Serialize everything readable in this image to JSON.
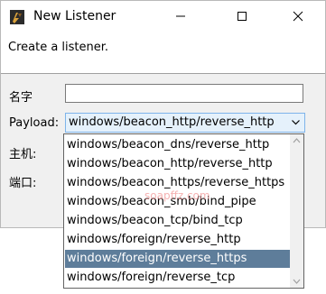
{
  "window": {
    "title": "New Listener",
    "description": "Create a listener."
  },
  "form": {
    "name_label": "名字",
    "name_value": "",
    "payload_label": "Payload:",
    "payload_value": "windows/beacon_http/reverse_http",
    "host_label": "主机:",
    "port_label": "端口:"
  },
  "dropdown": {
    "options": [
      "windows/beacon_dns/reverse_http",
      "windows/beacon_http/reverse_http",
      "windows/beacon_https/reverse_https",
      "windows/beacon_smb/bind_pipe",
      "windows/beacon_tcp/bind_tcp",
      "windows/foreign/reverse_http",
      "windows/foreign/reverse_https",
      "windows/foreign/reverse_tcp"
    ],
    "highlighted_index": 6
  },
  "watermark": "soapffz.com",
  "colors": {
    "highlight": "#5e7d9a",
    "combo_focus_border": "#7eb4ea",
    "combo_focus_bg": "#e5f1fb",
    "watermark": "#f08a8a"
  },
  "icons": {
    "app": "cobalt-strike-icon",
    "minimize": "minimize-icon",
    "maximize": "maximize-icon",
    "close": "close-icon",
    "combo_arrow": "chevron-down-icon"
  }
}
